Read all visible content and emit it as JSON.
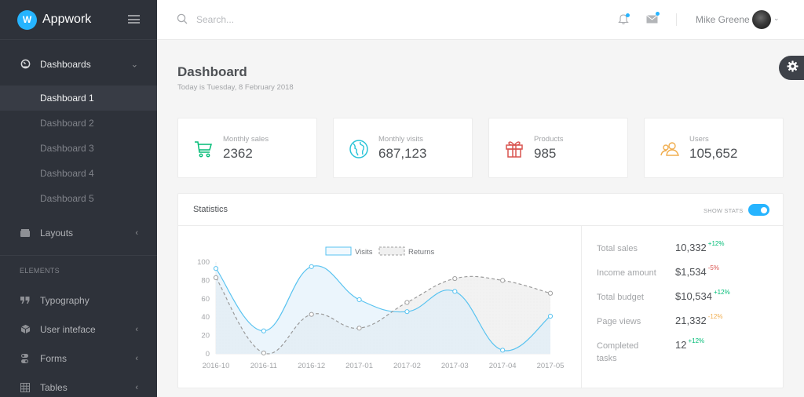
{
  "brand": {
    "name": "Appwork",
    "logo_letter": "W"
  },
  "sidebar": {
    "dashboards": {
      "label": "Dashboards",
      "icon": "dashboard-gauge-icon",
      "expanded": true
    },
    "sub_items": [
      {
        "label": "Dashboard 1",
        "active": true
      },
      {
        "label": "Dashboard 2",
        "active": false
      },
      {
        "label": "Dashboard 3",
        "active": false
      },
      {
        "label": "Dashboard 4",
        "active": false
      },
      {
        "label": "Dashboard 5",
        "active": false
      }
    ],
    "layouts": {
      "label": "Layouts",
      "icon": "layouts-icon"
    },
    "section_header": "ELEMENTS",
    "elements": [
      {
        "label": "Typography",
        "icon": "quote-icon",
        "has_children": false
      },
      {
        "label": "User inteface",
        "icon": "cube-icon",
        "has_children": true
      },
      {
        "label": "Forms",
        "icon": "toggles-icon",
        "has_children": true
      },
      {
        "label": "Tables",
        "icon": "grid-icon",
        "has_children": true
      }
    ]
  },
  "topbar": {
    "search_placeholder": "Search...",
    "search_value": "",
    "user_name": "Mike Greene",
    "notifications_badge": true,
    "messages_badge": true
  },
  "page": {
    "title": "Dashboard",
    "subtitle": "Today is Tuesday, 8 February 2018"
  },
  "stat_cards": [
    {
      "label": "Monthly sales",
      "value": "2362",
      "icon": "cart-icon",
      "color": "#02bc77"
    },
    {
      "label": "Monthly visits",
      "value": "687,123",
      "icon": "globe-icon",
      "color": "#28c3d7"
    },
    {
      "label": "Products",
      "value": "985",
      "icon": "gift-icon",
      "color": "#d9534f"
    },
    {
      "label": "Users",
      "value": "105,652",
      "icon": "users-icon",
      "color": "#f0ad4e"
    }
  ],
  "statistics": {
    "title": "Statistics",
    "toggle_label": "SHOW STATS",
    "toggle_on": true,
    "list": [
      {
        "label": "Total sales",
        "value": "10,332",
        "delta": "+12%",
        "tone": "pos"
      },
      {
        "label": "Income amount",
        "value": "$1,534",
        "delta": "-5%",
        "tone": "neg"
      },
      {
        "label": "Total budget",
        "value": "$10,534",
        "delta": "+12%",
        "tone": "pos"
      },
      {
        "label": "Page views",
        "value": "21,332",
        "delta": "-12%",
        "tone": "warn"
      },
      {
        "label": "Completed tasks",
        "value": "12",
        "delta": "+12%",
        "tone": "pos"
      }
    ]
  },
  "colors": {
    "accent": "#26b4ff",
    "sidebar_bg": "#2e323a",
    "visits_line": "#59c3f0",
    "returns_line": "#9a9a9a"
  },
  "chart_data": {
    "type": "area",
    "title": "",
    "xlabel": "",
    "ylabel": "",
    "x": [
      "2016-10",
      "2016-11",
      "2016-12",
      "2017-01",
      "2017-02",
      "2017-03",
      "2017-04",
      "2017-05"
    ],
    "ylim": [
      0,
      100
    ],
    "yticks": [
      0,
      20,
      40,
      60,
      80,
      100
    ],
    "grid": false,
    "legend": "top-center",
    "series": [
      {
        "name": "Visits",
        "values": [
          93,
          25,
          95,
          59,
          46,
          68,
          4,
          41
        ],
        "style": "solid"
      },
      {
        "name": "Returns",
        "values": [
          83,
          1,
          43,
          28,
          56,
          82,
          80,
          66
        ],
        "style": "dashed"
      }
    ]
  }
}
